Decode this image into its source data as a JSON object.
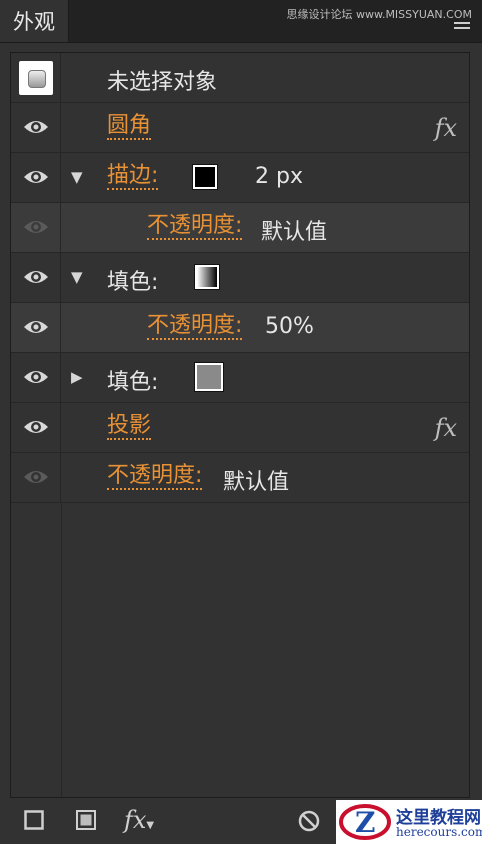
{
  "panel": {
    "tab_label": "外观",
    "watermark": "思缘设计论坛 www.MISSYUAN.COM"
  },
  "rows": [
    {
      "label": "未选择对象"
    },
    {
      "label": "圆角",
      "fx": "fx"
    },
    {
      "label": "描边:",
      "value": "2 px"
    },
    {
      "label": "不透明度:",
      "value": "默认值"
    },
    {
      "label": "填色:"
    },
    {
      "label": "不透明度:",
      "value": "50%"
    },
    {
      "label": "填色:"
    },
    {
      "label": "投影",
      "fx": "fx"
    },
    {
      "label": "不透明度:",
      "value": "默认值"
    }
  ],
  "bottom_toolbar": {
    "fx_label": "fx"
  },
  "logo": {
    "title": "这里教程网",
    "url": "herecours.com"
  },
  "colors": {
    "accent_orange": "#e89235",
    "panel_bg": "#323232"
  }
}
